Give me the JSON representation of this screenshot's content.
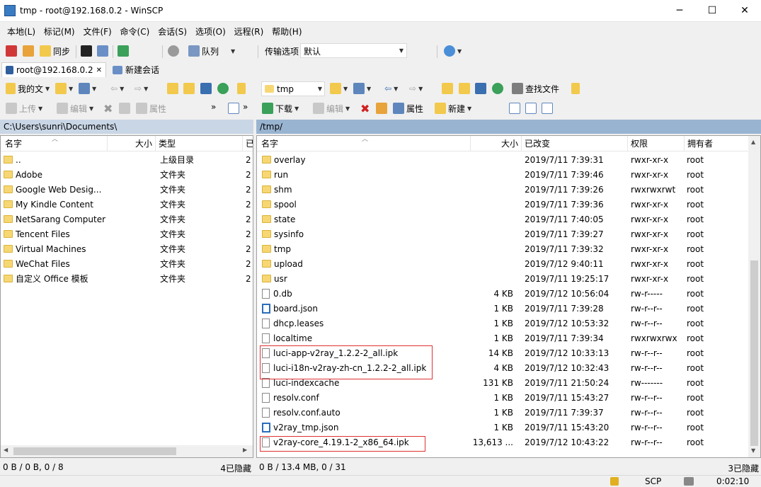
{
  "window": {
    "title": "tmp - root@192.168.0.2 - WinSCP",
    "minimize": "─",
    "maximize": "☐",
    "close": "✕"
  },
  "menu": [
    "本地(L)",
    "标记(M)",
    "文件(F)",
    "命令(C)",
    "会话(S)",
    "选项(O)",
    "远程(R)",
    "帮助(H)"
  ],
  "toolbar": {
    "sync_label": "同步",
    "queue_label": "队列",
    "transfer_label": "传输选项",
    "transfer_value": "默认"
  },
  "tabs": {
    "session": "root@192.168.0.2",
    "close": "✕",
    "new_session": "新建会话"
  },
  "left": {
    "location_label": "我的文",
    "upload_label": "上传",
    "edit_label": "编辑",
    "props_label": "属性",
    "path": "C:\\Users\\sunri\\Documents\\",
    "columns": {
      "name": "名字",
      "size": "大小",
      "type": "类型",
      "changed": "已"
    },
    "rows": [
      {
        "name": "..",
        "type": "上级目录",
        "changed": "2",
        "kind": "up"
      },
      {
        "name": "Adobe",
        "type": "文件夹",
        "changed": "2",
        "kind": "folder"
      },
      {
        "name": "Google Web Desig...",
        "type": "文件夹",
        "changed": "2",
        "kind": "folder"
      },
      {
        "name": "My Kindle Content",
        "type": "文件夹",
        "changed": "2",
        "kind": "folder"
      },
      {
        "name": "NetSarang Computer",
        "type": "文件夹",
        "changed": "2",
        "kind": "folder"
      },
      {
        "name": "Tencent Files",
        "type": "文件夹",
        "changed": "2",
        "kind": "folder"
      },
      {
        "name": "Virtual Machines",
        "type": "文件夹",
        "changed": "2",
        "kind": "folder"
      },
      {
        "name": "WeChat Files",
        "type": "文件夹",
        "changed": "2",
        "kind": "folder"
      },
      {
        "name": "自定义 Office 模板",
        "type": "文件夹",
        "changed": "2",
        "kind": "folder"
      }
    ],
    "status": "0 B / 0 B,  0 / 8",
    "hidden": "4已隐藏"
  },
  "right": {
    "location_label": "tmp",
    "download_label": "下载",
    "edit_label": "编辑",
    "props_label": "属性",
    "new_label": "新建",
    "find_label": "查找文件",
    "path": "/tmp/",
    "columns": {
      "name": "名字",
      "size": "大小",
      "changed": "已改变",
      "rights": "权限",
      "owner": "拥有者"
    },
    "rows": [
      {
        "name": "overlay",
        "size": "",
        "changed": "2019/7/11 7:39:31",
        "rights": "rwxr-xr-x",
        "owner": "root",
        "kind": "folder"
      },
      {
        "name": "run",
        "size": "",
        "changed": "2019/7/11 7:39:46",
        "rights": "rwxr-xr-x",
        "owner": "root",
        "kind": "folder"
      },
      {
        "name": "shm",
        "size": "",
        "changed": "2019/7/11 7:39:26",
        "rights": "rwxrwxrwt",
        "owner": "root",
        "kind": "folder"
      },
      {
        "name": "spool",
        "size": "",
        "changed": "2019/7/11 7:39:36",
        "rights": "rwxr-xr-x",
        "owner": "root",
        "kind": "folder"
      },
      {
        "name": "state",
        "size": "",
        "changed": "2019/7/11 7:40:05",
        "rights": "rwxr-xr-x",
        "owner": "root",
        "kind": "folder"
      },
      {
        "name": "sysinfo",
        "size": "",
        "changed": "2019/7/11 7:39:27",
        "rights": "rwxr-xr-x",
        "owner": "root",
        "kind": "folder"
      },
      {
        "name": "tmp",
        "size": "",
        "changed": "2019/7/11 7:39:32",
        "rights": "rwxr-xr-x",
        "owner": "root",
        "kind": "folder"
      },
      {
        "name": "upload",
        "size": "",
        "changed": "2019/7/12 9:40:11",
        "rights": "rwxr-xr-x",
        "owner": "root",
        "kind": "folder"
      },
      {
        "name": "usr",
        "size": "",
        "changed": "2019/7/11 19:25:17",
        "rights": "rwxr-xr-x",
        "owner": "root",
        "kind": "folder"
      },
      {
        "name": "0.db",
        "size": "4 KB",
        "changed": "2019/7/12 10:56:04",
        "rights": "rw-r-----",
        "owner": "root",
        "kind": "file"
      },
      {
        "name": "board.json",
        "size": "1 KB",
        "changed": "2019/7/11 7:39:28",
        "rights": "rw-r--r--",
        "owner": "root",
        "kind": "json"
      },
      {
        "name": "dhcp.leases",
        "size": "1 KB",
        "changed": "2019/7/12 10:53:32",
        "rights": "rw-r--r--",
        "owner": "root",
        "kind": "file"
      },
      {
        "name": "localtime",
        "size": "1 KB",
        "changed": "2019/7/11 7:39:34",
        "rights": "rwxrwxrwx",
        "owner": "root",
        "kind": "file"
      },
      {
        "name": "luci-app-v2ray_1.2.2-2_all.ipk",
        "size": "14 KB",
        "changed": "2019/7/12 10:33:13",
        "rights": "rw-r--r--",
        "owner": "root",
        "kind": "file"
      },
      {
        "name": "luci-i18n-v2ray-zh-cn_1.2.2-2_all.ipk",
        "size": "4 KB",
        "changed": "2019/7/12 10:32:43",
        "rights": "rw-r--r--",
        "owner": "root",
        "kind": "file"
      },
      {
        "name": "luci-indexcache",
        "size": "131 KB",
        "changed": "2019/7/11 21:50:24",
        "rights": "rw-------",
        "owner": "root",
        "kind": "file"
      },
      {
        "name": "resolv.conf",
        "size": "1 KB",
        "changed": "2019/7/11 15:43:27",
        "rights": "rw-r--r--",
        "owner": "root",
        "kind": "file"
      },
      {
        "name": "resolv.conf.auto",
        "size": "1 KB",
        "changed": "2019/7/11 7:39:37",
        "rights": "rw-r--r--",
        "owner": "root",
        "kind": "file"
      },
      {
        "name": "v2ray_tmp.json",
        "size": "1 KB",
        "changed": "2019/7/11 15:43:20",
        "rights": "rw-r--r--",
        "owner": "root",
        "kind": "json"
      },
      {
        "name": "v2ray-core_4.19.1-2_x86_64.ipk",
        "size": "13,613 ...",
        "changed": "2019/7/12 10:43:22",
        "rights": "rw-r--r--",
        "owner": "root",
        "kind": "file"
      }
    ],
    "status": "0 B / 13.4 MB,  0 / 31",
    "hidden": "3已隐藏"
  },
  "statusbar": {
    "protocol": "SCP",
    "elapsed": "0:02:10"
  }
}
